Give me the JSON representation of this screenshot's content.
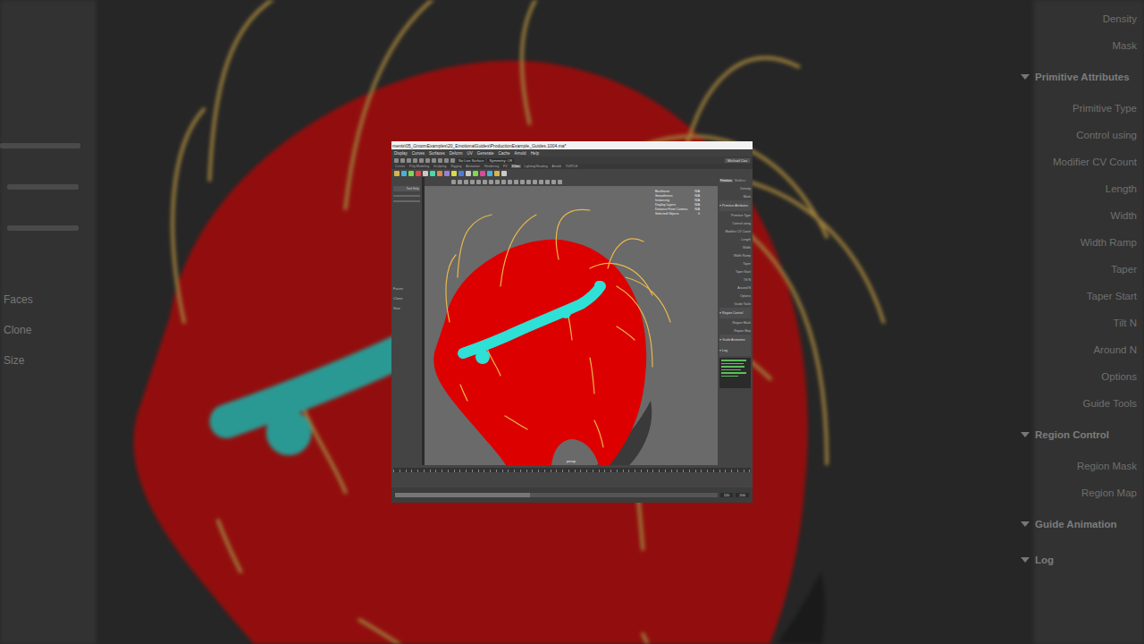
{
  "window": {
    "title": "ments\\05_GroomExamples\\20_EmotionalGuides\\ProductionExample_Guides.1004.ma*"
  },
  "menu": [
    "Display",
    "Curves",
    "Surfaces",
    "Deform",
    "UV",
    "Generate",
    "Cache",
    "Arnold",
    "Help"
  ],
  "status_line": {
    "live_surface": "No Live Surface",
    "symmetry": "Symmetry: Off",
    "user": "Michael Cas"
  },
  "shelf_tabs": [
    {
      "label": "Curves",
      "selected": false
    },
    {
      "label": "Poly Modeling",
      "selected": false
    },
    {
      "label": "Sculpting",
      "selected": false
    },
    {
      "label": "Rigging",
      "selected": false
    },
    {
      "label": "Animation",
      "selected": false
    },
    {
      "label": "Rendering",
      "selected": false
    },
    {
      "label": "FX",
      "selected": false
    },
    {
      "label": "XGen",
      "selected": true
    },
    {
      "label": "Lighting/Shading",
      "selected": false
    },
    {
      "label": "Arnold",
      "selected": false
    },
    {
      "label": "TURTLE",
      "selected": false
    }
  ],
  "tool_panel": {
    "title": "Tool Help",
    "labels": [
      "Faces",
      "Clone",
      "Size"
    ]
  },
  "hud": [
    {
      "label": "Backfaces",
      "value": "N/A"
    },
    {
      "label": "Smoothness",
      "value": "N/A"
    },
    {
      "label": "Instancing",
      "value": "N/A"
    },
    {
      "label": "Display Layers",
      "value": "N/A"
    },
    {
      "label": "Distance From Camera",
      "value": "N/A"
    },
    {
      "label": "Selected Objects",
      "value": "0"
    }
  ],
  "viewport": {
    "camera": "persp"
  },
  "attribute_tabs": [
    {
      "label": "Primitives",
      "selected": true
    },
    {
      "label": "Modifiers",
      "selected": false
    }
  ],
  "attributes": [
    {
      "text": "Density",
      "kind": "label"
    },
    {
      "text": "Mask",
      "kind": "label"
    },
    {
      "text": "Primitive Attributes",
      "kind": "header"
    },
    {
      "text": "Primitive Type",
      "kind": "label"
    },
    {
      "text": "Control using",
      "kind": "label"
    },
    {
      "text": "Modifier CV Count",
      "kind": "label"
    },
    {
      "text": "Length",
      "kind": "label"
    },
    {
      "text": "Width",
      "kind": "label"
    },
    {
      "text": "Width Ramp",
      "kind": "label"
    },
    {
      "text": "Taper",
      "kind": "label"
    },
    {
      "text": "Taper Start",
      "kind": "label"
    },
    {
      "text": "Tilt N",
      "kind": "label"
    },
    {
      "text": "Around N",
      "kind": "label"
    },
    {
      "text": "Options",
      "kind": "label"
    },
    {
      "text": "Guide Tools",
      "kind": "label"
    },
    {
      "text": "Region Control",
      "kind": "header"
    },
    {
      "text": "Region Mask",
      "kind": "label"
    },
    {
      "text": "Region Map",
      "kind": "label"
    },
    {
      "text": "Guide Animation",
      "kind": "header"
    },
    {
      "text": "Log",
      "kind": "header"
    }
  ],
  "timeline": {
    "start": "120",
    "end": "200",
    "level": 0.42
  }
}
